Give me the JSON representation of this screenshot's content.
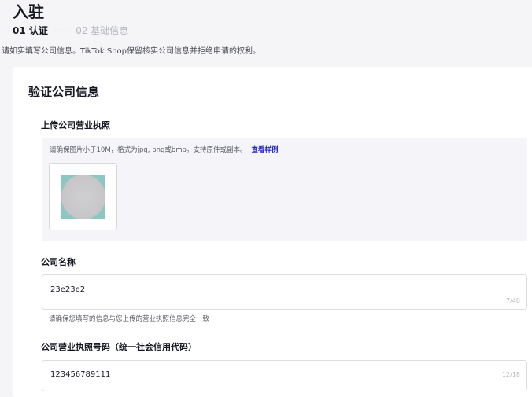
{
  "header": {
    "title": "入驻",
    "steps": [
      {
        "label": "01 认证",
        "active": true
      },
      {
        "label": "02 基础信息",
        "active": false
      }
    ],
    "step_separator": "·····",
    "intro": "请如实填写公司信息。TikTok Shop保留核实公司信息并拒绝申请的权利。"
  },
  "card": {
    "title": "验证公司信息",
    "license_upload": {
      "label": "上传公司营业执照",
      "hint": "请确保图片小于10M，格式为jpg, png或bmp。支持原件或副本。",
      "view_sample": "查看样例"
    },
    "company_name": {
      "label": "公司名称",
      "value": "23e23e2",
      "counter": "7/40",
      "help": "请确保您填写的信息与您上传的营业执照信息完全一致"
    },
    "license_number": {
      "label": "公司营业执照号码（统一社会信用代码）",
      "value": "123456789111",
      "counter": "12/18"
    }
  },
  "colors": {
    "page_background": "#f5f5f7",
    "card_background": "#ffffff",
    "upload_background": "#f4f4f9",
    "link": "#2020c8",
    "text_primary": "#161823",
    "text_secondary": "#5a5c66",
    "text_muted": "#b5b7bf",
    "thumbnail_teal": "#8cc7c4"
  }
}
